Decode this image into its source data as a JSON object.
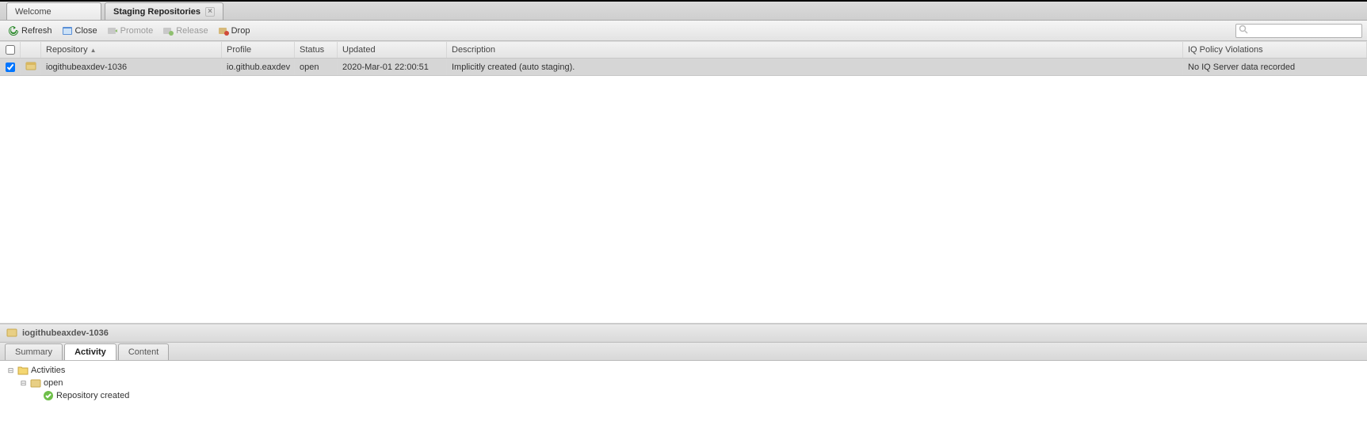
{
  "tabs": {
    "welcome": "Welcome",
    "staging": "Staging Repositories"
  },
  "toolbar": {
    "refresh": "Refresh",
    "close": "Close",
    "promote": "Promote",
    "release": "Release",
    "drop": "Drop"
  },
  "search": {
    "placeholder": ""
  },
  "columns": {
    "repository": "Repository",
    "profile": "Profile",
    "status": "Status",
    "updated": "Updated",
    "description": "Description",
    "iq": "IQ Policy Violations"
  },
  "rows": [
    {
      "repository": "iogithubeaxdev-1036",
      "profile": "io.github.eaxdev",
      "status": "open",
      "updated": "2020-Mar-01 22:00:51",
      "description": "Implicitly created (auto staging).",
      "iq": "No IQ Server data recorded"
    }
  ],
  "detail": {
    "title": "iogithubeaxdev-1036",
    "tabs": {
      "summary": "Summary",
      "activity": "Activity",
      "content": "Content"
    },
    "tree": {
      "root": "Activities",
      "node1": "open",
      "leaf1": "Repository created"
    }
  }
}
